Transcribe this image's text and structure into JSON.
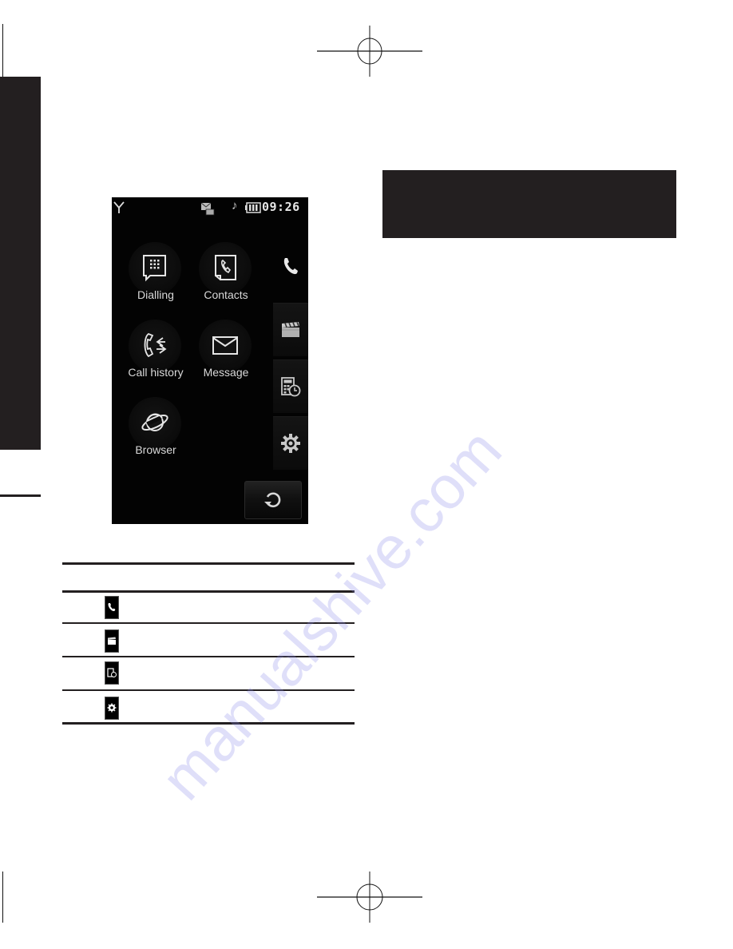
{
  "page": {
    "header_box_text": "",
    "watermark": "manualshive.com"
  },
  "phone": {
    "status_bar": {
      "signal_icon": "signal-antenna-icon",
      "message_icon": "new-message-icon",
      "ringtone_icon": "music-note-icon",
      "battery_icon": "battery-icon",
      "time": "09:26"
    },
    "apps": [
      {
        "label": "Dialling",
        "icon": "dialpad-icon"
      },
      {
        "label": "Contacts",
        "icon": "contacts-icon"
      },
      {
        "label": "Call history",
        "icon": "call-history-icon"
      },
      {
        "label": "Message",
        "icon": "envelope-icon"
      },
      {
        "label": "Browser",
        "icon": "planet-icon"
      }
    ],
    "categories": [
      {
        "name": "communication",
        "icon": "phone-handset-icon",
        "active": true
      },
      {
        "name": "entertainment",
        "icon": "clapperboard-icon",
        "active": false
      },
      {
        "name": "utilities",
        "icon": "calculator-clock-icon",
        "active": false
      },
      {
        "name": "settings",
        "icon": "gear-icon",
        "active": false
      }
    ],
    "rotate_button_icon": "rotate-icon"
  },
  "table": {
    "headers": [
      "",
      ""
    ],
    "rows": [
      {
        "icon": "phone-handset-icon",
        "description": ""
      },
      {
        "icon": "clapperboard-icon",
        "description": ""
      },
      {
        "icon": "calculator-clock-icon",
        "description": ""
      },
      {
        "icon": "gear-icon",
        "description": ""
      }
    ]
  }
}
